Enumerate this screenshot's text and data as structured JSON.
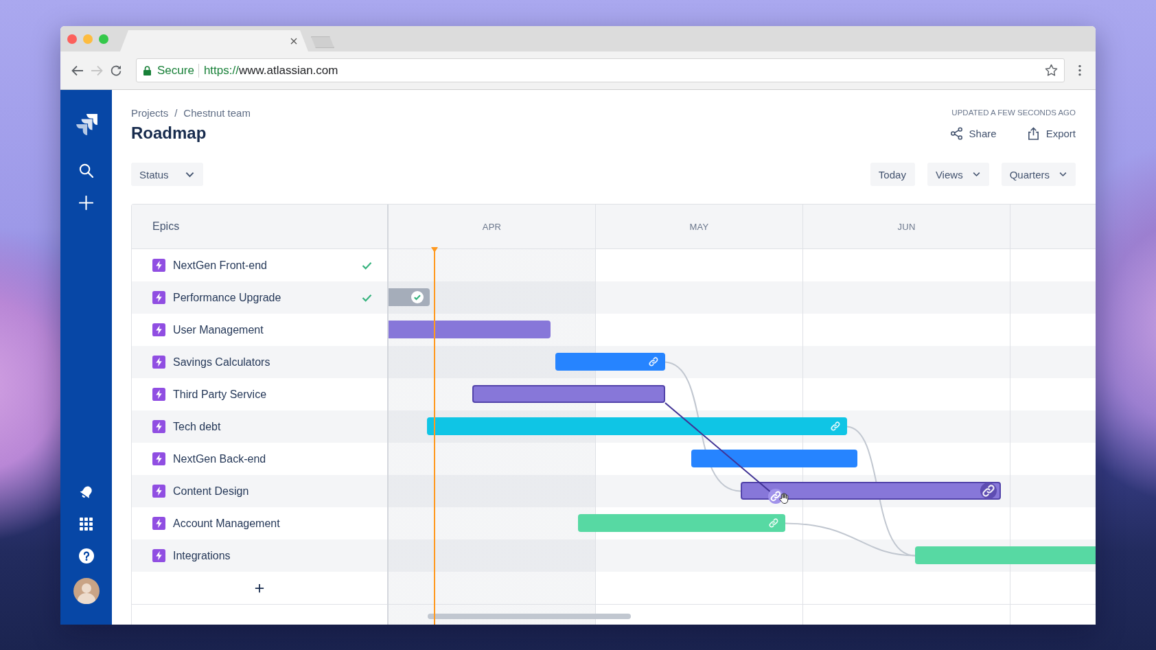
{
  "browser": {
    "secure_label": "Secure",
    "url_scheme": "https://",
    "url_host": "www.atlassian.com",
    "bookmarked": false
  },
  "header": {
    "breadcrumbs": [
      "Projects",
      "Chestnut team"
    ],
    "separator": "/",
    "title": "Roadmap",
    "updated": "UPDATED A FEW SECONDS AGO",
    "actions": [
      {
        "label": "Share",
        "kind": "share"
      },
      {
        "label": "Export",
        "kind": "export"
      }
    ]
  },
  "toolbar": {
    "filters": [
      {
        "label": "Status",
        "kind": "dropdown"
      }
    ],
    "controls": [
      {
        "label": "Today",
        "kind": "button"
      },
      {
        "label": "Views",
        "kind": "dropdown"
      },
      {
        "label": "Quarters",
        "kind": "dropdown"
      }
    ]
  },
  "roadmap": {
    "epics_heading": "Epics",
    "months": [
      "APR",
      "MAY",
      "JUN"
    ],
    "epics": [
      {
        "name": "NextGen Front-end",
        "done": true
      },
      {
        "name": "Performance Upgrade",
        "done": true,
        "bar": {
          "color": "#a5adba",
          "linked": false,
          "highlighted": false
        }
      },
      {
        "name": "User Management",
        "done": false,
        "bar": {
          "color": "#8777d9",
          "linked": false,
          "highlighted": false
        }
      },
      {
        "name": "Savings Calculators",
        "done": false,
        "bar": {
          "color": "#2684ff",
          "linked": true,
          "highlighted": false
        }
      },
      {
        "name": "Third Party Service",
        "done": false,
        "bar": {
          "color": "#8777d9",
          "linked": false,
          "highlighted": true
        }
      },
      {
        "name": "Tech debt",
        "done": false,
        "bar": {
          "color": "#0fc5e5",
          "linked": true,
          "highlighted": false
        }
      },
      {
        "name": "NextGen Back-end",
        "done": false,
        "bar": {
          "color": "#2684ff",
          "linked": false,
          "highlighted": false
        }
      },
      {
        "name": "Content Design",
        "done": false,
        "bar": {
          "color": "#8777d9",
          "linked": true,
          "highlighted": true
        }
      },
      {
        "name": "Account Management",
        "done": false,
        "bar": {
          "color": "#57d9a3",
          "linked": true,
          "highlighted": false
        }
      },
      {
        "name": "Integrations",
        "done": false,
        "bar": {
          "color": "#57d9a3",
          "linked": false,
          "highlighted": false
        }
      }
    ]
  }
}
